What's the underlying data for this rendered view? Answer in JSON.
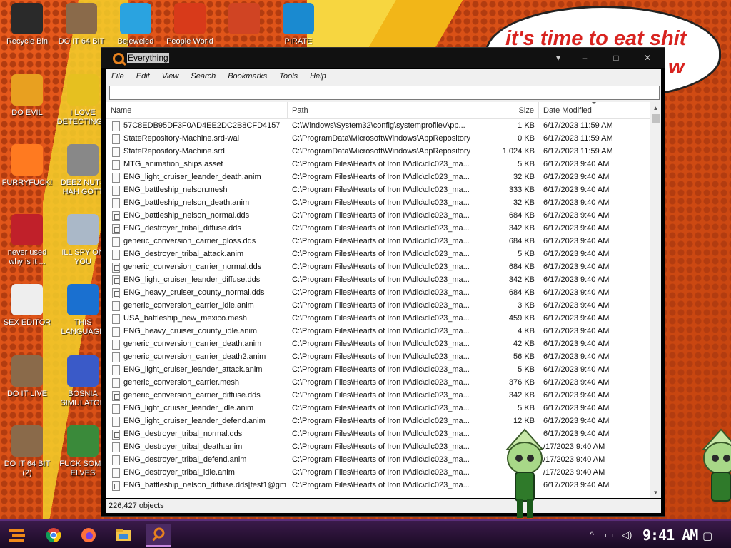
{
  "wallpaper": {
    "speech_text": "it's time to eat shit",
    "speech_text_2": "w"
  },
  "desktop_icons": [
    {
      "label": "Recycle Bin",
      "icon": "recycle-bin-icon",
      "color": "#2a2a2a"
    },
    {
      "label": "DO IT 64 BIT",
      "icon": "portrait-icon",
      "color": "#8a6a4a"
    },
    {
      "label": "Bejeweled",
      "icon": "gem-icon",
      "color": "#2aa3e0"
    },
    {
      "label": "People World of I LOVE EMOTE",
      "icon": "p-icon",
      "color": "#d83a1a"
    },
    {
      "label": "",
      "icon": "powerpoint-icon",
      "color": "#d04423"
    },
    {
      "label": "PIRATE",
      "icon": "dolphin-icon",
      "color": "#1a8ad0"
    },
    {
      "label": "DO EVIL",
      "icon": "chrome-icon",
      "color": "#e8a020"
    },
    {
      "label": "I LOVE DETECTING...",
      "icon": "de-icon",
      "color": "#e6c020"
    },
    {
      "label": "FURRYFUCK!",
      "icon": "firefox-icon",
      "color": "#ff7a20"
    },
    {
      "label": "DEEZ NUTS HAH GOTT",
      "icon": "windows-icon",
      "color": "#888888"
    },
    {
      "label": "never used why is it ...",
      "icon": "devcpp-icon",
      "color": "#c0202a"
    },
    {
      "label": "ILL SPY ON YOU",
      "icon": "magnifier-icon",
      "color": "#aab8c8"
    },
    {
      "label": "SEX EDITOR",
      "icon": "hxd-icon",
      "color": "#eeeeee"
    },
    {
      "label": "THIS LANGUAGE",
      "icon": "goland-icon",
      "color": "#1a70d0"
    },
    {
      "label": "DO IT LIVE",
      "icon": "portrait-icon",
      "color": "#8a6a4a"
    },
    {
      "label": "BOSNIA SIMULATOR",
      "icon": "virus-icon",
      "color": "#3a5ac8"
    },
    {
      "label": "DO IT 64 BIT (2)",
      "icon": "portrait-icon",
      "color": "#8a6a4a"
    },
    {
      "label": "FUCK SOME ELVES",
      "icon": "elf-icon",
      "color": "#3a8a3a"
    }
  ],
  "window": {
    "title": "Everything",
    "controls": {
      "minimize": "–",
      "maximize": "□",
      "close": "✕"
    },
    "menu": [
      "File",
      "Edit",
      "View",
      "Search",
      "Bookmarks",
      "Tools",
      "Help"
    ],
    "search": {
      "value": "",
      "placeholder": ""
    },
    "columns": {
      "name": "Name",
      "path": "Path",
      "size": "Size",
      "date": "Date Modified"
    },
    "rows": [
      {
        "name": "57C8EDB95DF3F0AD4EE2DC2B8CFD4157",
        "path": "C:\\Windows\\System32\\config\\systemprofile\\App...",
        "size": "1 KB",
        "date": "6/17/2023 11:59 AM",
        "icon": "file"
      },
      {
        "name": "StateRepository-Machine.srd-wal",
        "path": "C:\\ProgramData\\Microsoft\\Windows\\AppRepository",
        "size": "0 KB",
        "date": "6/17/2023 11:59 AM",
        "icon": "file"
      },
      {
        "name": "StateRepository-Machine.srd",
        "path": "C:\\ProgramData\\Microsoft\\Windows\\AppRepository",
        "size": "1,024 KB",
        "date": "6/17/2023 11:59 AM",
        "icon": "file"
      },
      {
        "name": "MTG_animation_ships.asset",
        "path": "C:\\Program Files\\Hearts of Iron IV\\dlc\\dlc023_ma...",
        "size": "5 KB",
        "date": "6/17/2023 9:40 AM",
        "icon": "file"
      },
      {
        "name": "ENG_light_cruiser_leander_death.anim",
        "path": "C:\\Program Files\\Hearts of Iron IV\\dlc\\dlc023_ma...",
        "size": "32 KB",
        "date": "6/17/2023 9:40 AM",
        "icon": "file"
      },
      {
        "name": "ENG_battleship_nelson.mesh",
        "path": "C:\\Program Files\\Hearts of Iron IV\\dlc\\dlc023_ma...",
        "size": "333 KB",
        "date": "6/17/2023 9:40 AM",
        "icon": "file"
      },
      {
        "name": "ENG_battleship_nelson_death.anim",
        "path": "C:\\Program Files\\Hearts of Iron IV\\dlc\\dlc023_ma...",
        "size": "32 KB",
        "date": "6/17/2023 9:40 AM",
        "icon": "file"
      },
      {
        "name": "ENG_battleship_nelson_normal.dds",
        "path": "C:\\Program Files\\Hearts of Iron IV\\dlc\\dlc023_ma...",
        "size": "684 KB",
        "date": "6/17/2023 9:40 AM",
        "icon": "img"
      },
      {
        "name": "ENG_destroyer_tribal_diffuse.dds",
        "path": "C:\\Program Files\\Hearts of Iron IV\\dlc\\dlc023_ma...",
        "size": "342 KB",
        "date": "6/17/2023 9:40 AM",
        "icon": "img"
      },
      {
        "name": "generic_conversion_carrier_gloss.dds",
        "path": "C:\\Program Files\\Hearts of Iron IV\\dlc\\dlc023_ma...",
        "size": "684 KB",
        "date": "6/17/2023 9:40 AM",
        "icon": "file"
      },
      {
        "name": "ENG_destroyer_tribal_attack.anim",
        "path": "C:\\Program Files\\Hearts of Iron IV\\dlc\\dlc023_ma...",
        "size": "5 KB",
        "date": "6/17/2023 9:40 AM",
        "icon": "file"
      },
      {
        "name": "generic_conversion_carrier_normal.dds",
        "path": "C:\\Program Files\\Hearts of Iron IV\\dlc\\dlc023_ma...",
        "size": "684 KB",
        "date": "6/17/2023 9:40 AM",
        "icon": "img"
      },
      {
        "name": "ENG_light_cruiser_leander_diffuse.dds",
        "path": "C:\\Program Files\\Hearts of Iron IV\\dlc\\dlc023_ma...",
        "size": "342 KB",
        "date": "6/17/2023 9:40 AM",
        "icon": "img"
      },
      {
        "name": "ENG_heavy_cruiser_county_normal.dds",
        "path": "C:\\Program Files\\Hearts of Iron IV\\dlc\\dlc023_ma...",
        "size": "684 KB",
        "date": "6/17/2023 9:40 AM",
        "icon": "img"
      },
      {
        "name": "generic_conversion_carrier_idle.anim",
        "path": "C:\\Program Files\\Hearts of Iron IV\\dlc\\dlc023_ma...",
        "size": "3 KB",
        "date": "6/17/2023 9:40 AM",
        "icon": "file"
      },
      {
        "name": "USA_battleship_new_mexico.mesh",
        "path": "C:\\Program Files\\Hearts of Iron IV\\dlc\\dlc023_ma...",
        "size": "459 KB",
        "date": "6/17/2023 9:40 AM",
        "icon": "file"
      },
      {
        "name": "ENG_heavy_cruiser_county_idle.anim",
        "path": "C:\\Program Files\\Hearts of Iron IV\\dlc\\dlc023_ma...",
        "size": "4 KB",
        "date": "6/17/2023 9:40 AM",
        "icon": "file"
      },
      {
        "name": "generic_conversion_carrier_death.anim",
        "path": "C:\\Program Files\\Hearts of Iron IV\\dlc\\dlc023_ma...",
        "size": "42 KB",
        "date": "6/17/2023 9:40 AM",
        "icon": "file"
      },
      {
        "name": "generic_conversion_carrier_death2.anim",
        "path": "C:\\Program Files\\Hearts of Iron IV\\dlc\\dlc023_ma...",
        "size": "56 KB",
        "date": "6/17/2023 9:40 AM",
        "icon": "file"
      },
      {
        "name": "ENG_light_cruiser_leander_attack.anim",
        "path": "C:\\Program Files\\Hearts of Iron IV\\dlc\\dlc023_ma...",
        "size": "5 KB",
        "date": "6/17/2023 9:40 AM",
        "icon": "file"
      },
      {
        "name": "generic_conversion_carrier.mesh",
        "path": "C:\\Program Files\\Hearts of Iron IV\\dlc\\dlc023_ma...",
        "size": "376 KB",
        "date": "6/17/2023 9:40 AM",
        "icon": "file"
      },
      {
        "name": "generic_conversion_carrier_diffuse.dds",
        "path": "C:\\Program Files\\Hearts of Iron IV\\dlc\\dlc023_ma...",
        "size": "342 KB",
        "date": "6/17/2023 9:40 AM",
        "icon": "img"
      },
      {
        "name": "ENG_light_cruiser_leander_idle.anim",
        "path": "C:\\Program Files\\Hearts of Iron IV\\dlc\\dlc023_ma...",
        "size": "5 KB",
        "date": "6/17/2023 9:40 AM",
        "icon": "file"
      },
      {
        "name": "ENG_light_cruiser_leander_defend.anim",
        "path": "C:\\Program Files\\Hearts of Iron IV\\dlc\\dlc023_ma...",
        "size": "12 KB",
        "date": "6/17/2023 9:40 AM",
        "icon": "file"
      },
      {
        "name": "ENG_destroyer_tribal_normal.dds",
        "path": "C:\\Program Files\\Hearts of Iron IV\\dlc\\dlc023_ma...",
        "size": "",
        "date": "6/17/2023 9:40 AM",
        "icon": "img"
      },
      {
        "name": "ENG_destroyer_tribal_death.anim",
        "path": "C:\\Program Files\\Hearts of Iron IV\\dlc\\dlc023_ma...",
        "size": "",
        "date": "/17/2023 9:40 AM",
        "icon": "file"
      },
      {
        "name": "ENG_destroyer_tribal_defend.anim",
        "path": "C:\\Program Files\\Hearts of Iron IV\\dlc\\dlc023_ma...",
        "size": "",
        "date": "/17/2023 9:40 AM",
        "icon": "file"
      },
      {
        "name": "ENG_destroyer_tribal_idle.anim",
        "path": "C:\\Program Files\\Hearts of Iron IV\\dlc\\dlc023_ma...",
        "size": "",
        "date": "/17/2023 9:40 AM",
        "icon": "file"
      },
      {
        "name": "ENG_battleship_nelson_diffuse.dds[test1@gm...",
        "path": "C:\\Program Files\\Hearts of Iron IV\\dlc\\dlc023_ma...",
        "size": "",
        "date": "6/17/2023 9:40 AM",
        "icon": "img"
      }
    ],
    "status": "226,427 objects"
  },
  "taskbar": {
    "clock": "9:41 AM",
    "apps": [
      "start-button-icon",
      "chrome-icon",
      "firefox-icon",
      "file-explorer-icon",
      "everything-icon"
    ]
  }
}
